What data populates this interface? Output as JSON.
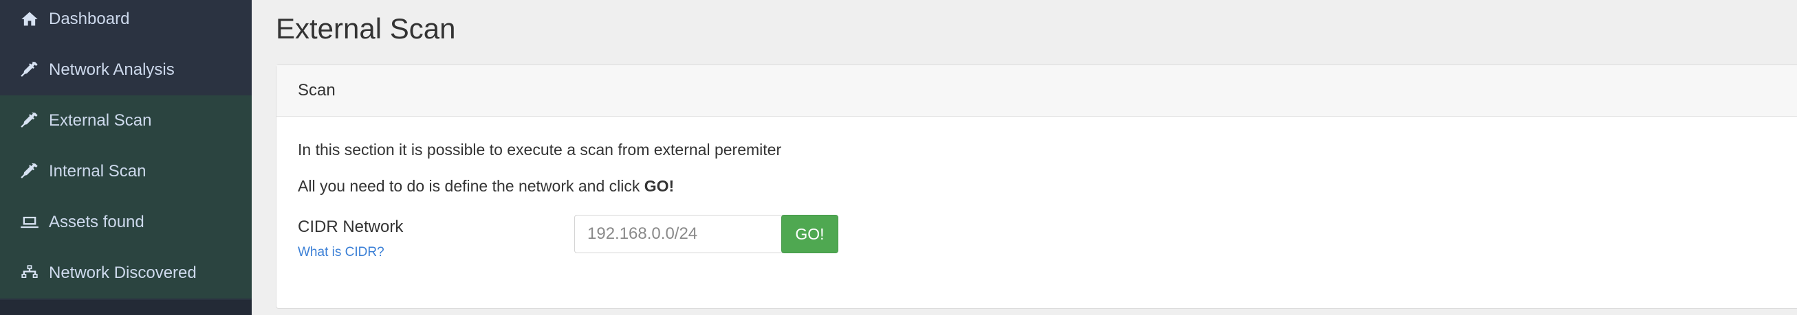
{
  "sidebar": {
    "items": [
      {
        "label": "Dashboard",
        "icon": "home-icon"
      },
      {
        "label": "Network Analysis",
        "icon": "syringe-icon"
      },
      {
        "label": "External Scan",
        "icon": "syringe-icon"
      },
      {
        "label": "Internal Scan",
        "icon": "syringe-icon"
      },
      {
        "label": "Assets found",
        "icon": "laptop-icon"
      },
      {
        "label": "Network Discovered",
        "icon": "sitemap-icon"
      }
    ]
  },
  "page": {
    "title": "External Scan"
  },
  "card": {
    "header": "Scan",
    "paragraph1": "In this section it is possible to execute a scan from external peremiter",
    "paragraph2_prefix": "All you need to do is define the network and click ",
    "paragraph2_bold": "GO!",
    "cidr_label": "CIDR Network",
    "help_link": "What is CIDR?",
    "cidr_placeholder": "192.168.0.0/24",
    "go_label": "GO!"
  },
  "colors": {
    "sidebar_bg": "#2b3341",
    "sidebar_active_bg": "#2b4440",
    "go_button": "#4fa851",
    "link": "#3a7fd6"
  }
}
